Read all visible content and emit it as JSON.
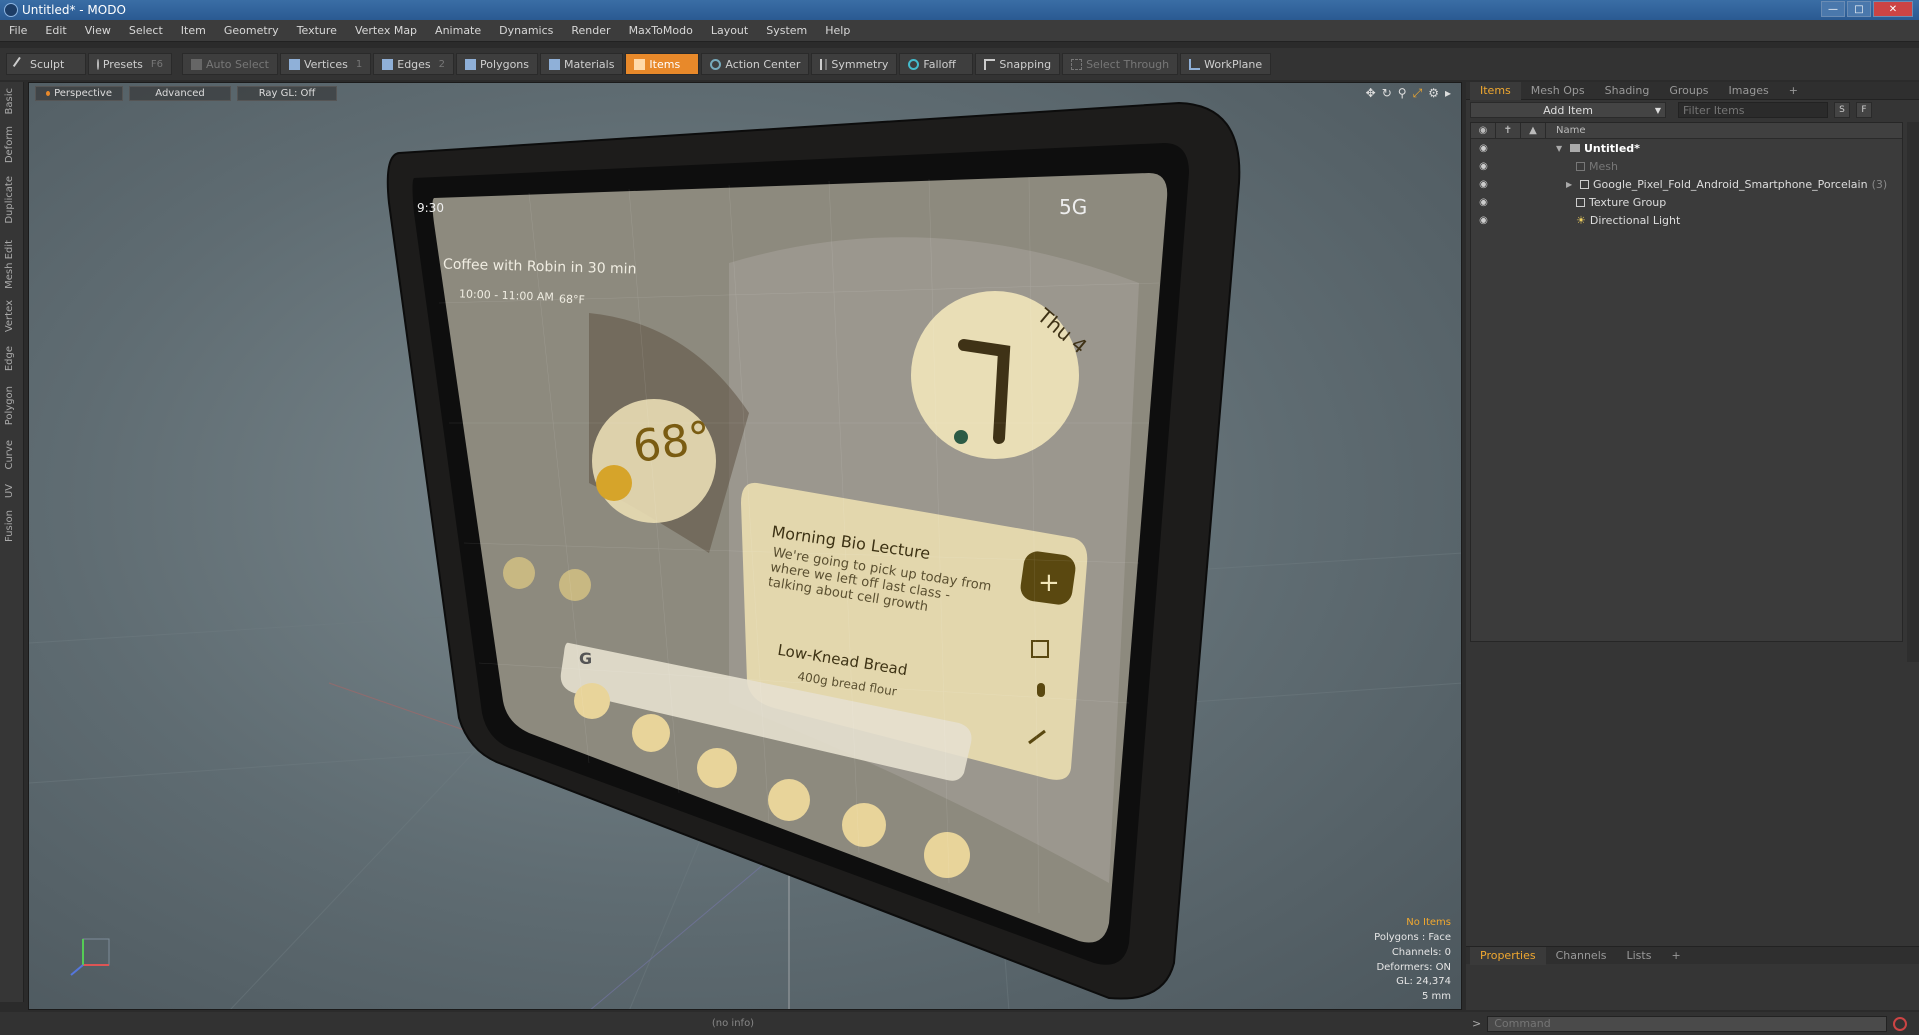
{
  "window": {
    "title": "Untitled* - MODO"
  },
  "menu": [
    "File",
    "Edit",
    "View",
    "Select",
    "Item",
    "Geometry",
    "Texture",
    "Vertex Map",
    "Animate",
    "Dynamics",
    "Render",
    "MaxToModo",
    "Layout",
    "System",
    "Help"
  ],
  "toolbar": {
    "sculpt": "Sculpt",
    "presets": "Presets",
    "presets_key": "F6",
    "auto_select": "Auto Select",
    "vertices": "Vertices",
    "vertices_key": "1",
    "edges": "Edges",
    "edges_key": "2",
    "polygons": "Polygons",
    "materials": "Materials",
    "items": "Items",
    "action_center": "Action Center",
    "symmetry": "Symmetry",
    "falloff": "Falloff",
    "snapping": "Snapping",
    "select_through": "Select Through",
    "workplane": "WorkPlane"
  },
  "left_tabs": [
    "Basic",
    "Deform",
    "Duplicate",
    "Mesh Edit",
    "Vertex",
    "Edge",
    "Polygon",
    "Curve",
    "UV",
    "Fusion"
  ],
  "viewport": {
    "view_mode": "Perspective",
    "shading": "Advanced",
    "raygl": "Ray GL: Off",
    "info": {
      "selection": "No Items",
      "polygons": "Polygons : Face",
      "channels": "Channels: 0",
      "deformers": "Deformers: ON",
      "gl": "GL: 24,374",
      "units": "5 mm"
    },
    "phone_screen": {
      "time": "9:30",
      "network": "5G",
      "event": "Coffee with Robin in 30 min",
      "event_time": "10:00 - 11:00 AM",
      "event_temp": "68°F",
      "weather_temp": "68°",
      "clock_day": "Thu 4",
      "note_title": "Morning Bio Lecture",
      "note_body": "We're going to pick up today from where we left off last class - talking about cell growth",
      "note2_title": "Low-Knead Bread",
      "note2_item": "400g bread flour",
      "search_glyph": "G"
    }
  },
  "items_panel": {
    "tabs": [
      "Items",
      "Mesh Ops",
      "Shading",
      "Groups",
      "Images"
    ],
    "add_item": "Add Item",
    "filter_placeholder": "Filter Items",
    "btn_s": "S",
    "btn_f": "F",
    "column_name": "Name",
    "tree": [
      {
        "label": "Untitled*",
        "level": 0
      },
      {
        "label": "Mesh",
        "level": 1
      },
      {
        "label": "Google_Pixel_Fold_Android_Smartphone_Porcelain",
        "suffix": "(3)",
        "level": 1
      },
      {
        "label": "Texture Group",
        "level": 1
      },
      {
        "label": "Directional Light",
        "level": 1
      }
    ]
  },
  "properties_panel": {
    "tabs": [
      "Properties",
      "Channels",
      "Lists"
    ]
  },
  "status": {
    "info": "(no info)"
  },
  "command": {
    "placeholder": "Command"
  }
}
